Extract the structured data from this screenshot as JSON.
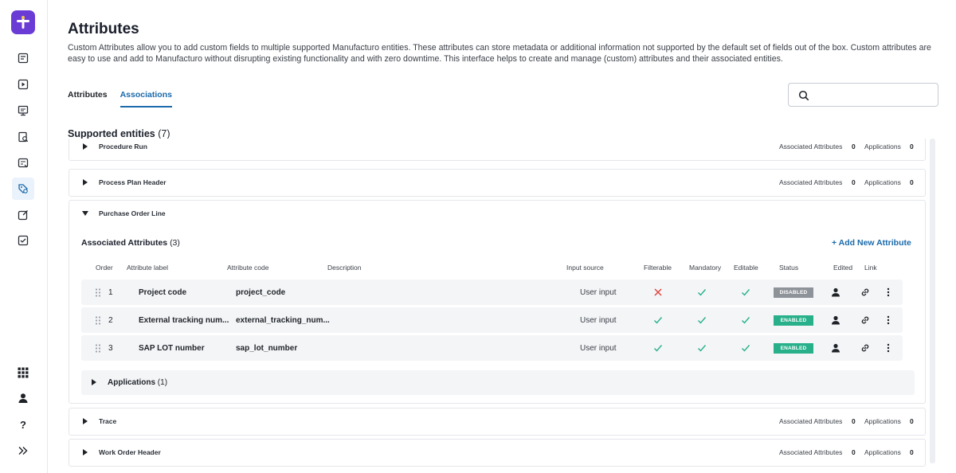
{
  "page": {
    "title": "Attributes",
    "description": "Custom Attributes allow you to add custom fields to multiple supported Manufacturo entities. These attributes can store metadata or additional information not supported by the default set of fields out of the box. Custom attributes are easy to use and add to Manufacturo without disrupting existing functionality and with zero downtime. This interface helps to create and manage (custom) attributes and their associated entities."
  },
  "tabs": [
    {
      "label": "Attributes",
      "active": false
    },
    {
      "label": "Associations",
      "active": true
    }
  ],
  "search": {
    "placeholder": "",
    "value": ""
  },
  "supported": {
    "label": "Supported entities",
    "count": "(7)"
  },
  "meta_labels": {
    "associated": "Associated Attributes",
    "applications": "Applications"
  },
  "entities": [
    {
      "name": "Procedure Run",
      "associated": "0",
      "applications": "0",
      "expanded": false
    },
    {
      "name": "Process Plan Header",
      "associated": "0",
      "applications": "0",
      "expanded": false
    },
    {
      "name": "Purchase Order Line",
      "expanded": true
    },
    {
      "name": "Trace",
      "associated": "0",
      "applications": "0",
      "expanded": false
    },
    {
      "name": "Work Order Header",
      "associated": "0",
      "applications": "0",
      "expanded": false
    }
  ],
  "expanded": {
    "assoc_title": "Associated Attributes",
    "assoc_count": "(3)",
    "add_label": "+ Add New Attribute",
    "columns": [
      "Order",
      "Attribute label",
      "Attribute code",
      "Description",
      "Input source",
      "Filterable",
      "Mandatory",
      "Editable",
      "Status",
      "Edited",
      "Link"
    ],
    "rows": [
      {
        "order": "1",
        "label": "Project code",
        "code": "project_code",
        "description": "",
        "input_source": "User input",
        "filterable": false,
        "mandatory": true,
        "editable": true,
        "status": "DISABLED"
      },
      {
        "order": "2",
        "label": "External tracking num...",
        "code": "external_tracking_num...",
        "description": "",
        "input_source": "User input",
        "filterable": true,
        "mandatory": true,
        "editable": true,
        "status": "ENABLED"
      },
      {
        "order": "3",
        "label": "SAP LOT number",
        "code": "sap_lot_number",
        "description": "",
        "input_source": "User input",
        "filterable": true,
        "mandatory": true,
        "editable": true,
        "status": "ENABLED"
      }
    ],
    "applications_label": "Applications",
    "applications_count": "(1)"
  },
  "colors": {
    "brand": "#6b3bd6",
    "accent": "#1a6aab",
    "enabled": "#27b08a",
    "disabled": "#8e9299",
    "check": "#27b08a",
    "cross": "#e0413a"
  },
  "icons": {
    "sidebar_top": [
      "report-icon",
      "play-icon",
      "monitor-icon",
      "inspection-icon",
      "document-icon",
      "attributes-icon",
      "edit-icon",
      "checklist-icon"
    ],
    "sidebar_bottom": [
      "apps-grid-icon",
      "user-icon",
      "help-icon",
      "expand-icon"
    ]
  }
}
